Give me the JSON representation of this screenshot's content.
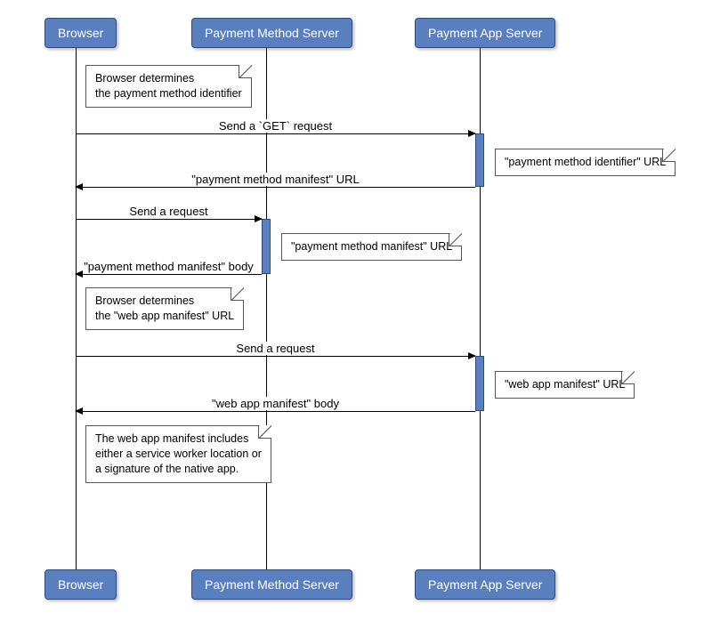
{
  "participants": {
    "browser": "Browser",
    "pms": "Payment Method Server",
    "pas": "Payment App Server"
  },
  "notes": {
    "n1_l1": "Browser determines",
    "n1_l2": "the payment method identifier",
    "n2": "\"payment method identifier\" URL",
    "n3": "\"payment method manifest\" URL",
    "n4_l1": "Browser determines",
    "n4_l2": "the \"web app manifest\" URL",
    "n5": "\"web app manifest\" URL",
    "n6_l1": "The web app manifest includes",
    "n6_l2": "either a service worker location or",
    "n6_l3": "a signature of the native app."
  },
  "messages": {
    "m1": "Send a `GET` request",
    "m2": "\"payment method manifest\" URL",
    "m3": "Send a request",
    "m4": "\"payment method manifest\" body",
    "m5": "Send a request",
    "m6": "\"web app manifest\" body"
  },
  "chart_data": {
    "type": "sequence-diagram",
    "participants": [
      "Browser",
      "Payment Method Server",
      "Payment App Server"
    ],
    "steps": [
      {
        "kind": "note",
        "over": "Browser",
        "text": "Browser determines the payment method identifier"
      },
      {
        "kind": "message",
        "from": "Browser",
        "to": "Payment App Server",
        "text": "Send a `GET` request"
      },
      {
        "kind": "note",
        "over": "Payment App Server",
        "text": "\"payment method identifier\" URL"
      },
      {
        "kind": "message",
        "from": "Payment App Server",
        "to": "Browser",
        "text": "\"payment method manifest\" URL"
      },
      {
        "kind": "message",
        "from": "Browser",
        "to": "Payment Method Server",
        "text": "Send a request"
      },
      {
        "kind": "note",
        "over": "Payment Method Server",
        "text": "\"payment method manifest\" URL"
      },
      {
        "kind": "message",
        "from": "Payment Method Server",
        "to": "Browser",
        "text": "\"payment method manifest\" body"
      },
      {
        "kind": "note",
        "over": "Browser",
        "text": "Browser determines the \"web app manifest\" URL"
      },
      {
        "kind": "message",
        "from": "Browser",
        "to": "Payment App Server",
        "text": "Send a request"
      },
      {
        "kind": "note",
        "over": "Payment App Server",
        "text": "\"web app manifest\" URL"
      },
      {
        "kind": "message",
        "from": "Payment App Server",
        "to": "Browser",
        "text": "\"web app manifest\" body"
      },
      {
        "kind": "note",
        "over": "Browser",
        "text": "The web app manifest includes either a service worker location or a signature of the native app."
      }
    ]
  }
}
